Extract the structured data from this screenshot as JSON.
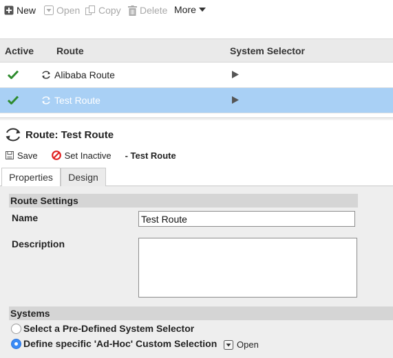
{
  "toolbar": {
    "new_label": "New",
    "open_label": "Open",
    "copy_label": "Copy",
    "delete_label": "Delete",
    "more_label": "More"
  },
  "grid": {
    "columns": [
      "Active",
      "Route",
      "System Selector"
    ],
    "rows": [
      {
        "active": true,
        "route": "Alibaba Route",
        "selected": false
      },
      {
        "active": true,
        "route": "Test Route",
        "selected": true
      }
    ]
  },
  "detail": {
    "title": "Route: Test Route",
    "save_label": "Save",
    "set_inactive_label": "Set Inactive",
    "subtitle": "- Test Route"
  },
  "tabs": [
    {
      "label": "Properties",
      "active": true
    },
    {
      "label": "Design",
      "active": false
    }
  ],
  "route_settings": {
    "heading": "Route Settings",
    "name_label": "Name",
    "name_value": "Test Route",
    "description_label": "Description",
    "description_value": ""
  },
  "systems": {
    "heading": "Systems",
    "option_predefined": "Select a Pre-Defined System Selector",
    "option_adhoc": "Define specific 'Ad-Hoc' Custom Selection",
    "selected_option": "adhoc",
    "open_label": "Open"
  },
  "colors": {
    "selected_row": "#a9d0f5",
    "check_green": "#2e8b2e",
    "inactive_red": "#e02020",
    "radio_blue": "#3b8bf5"
  },
  "icons": {
    "new": "plus-square-icon",
    "open": "open-dropdown-icon",
    "copy": "copy-icon",
    "delete": "trash-icon",
    "active": "checkmark-icon",
    "route": "route-cycle-icon",
    "selector": "play-icon",
    "save": "floppy-icon",
    "inactive": "no-entry-icon"
  }
}
